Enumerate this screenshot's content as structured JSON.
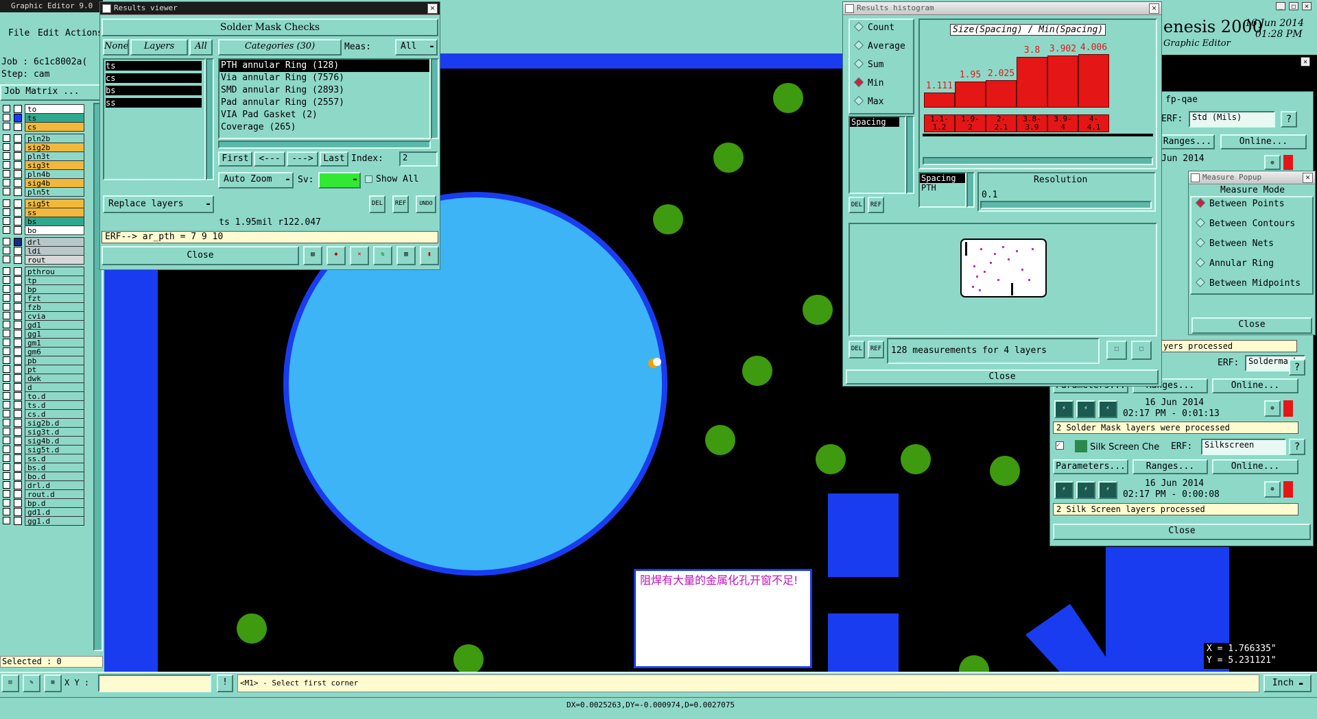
{
  "main_window": {
    "menus": [
      "File",
      "Edit",
      "Actions"
    ],
    "window_title": "Graphic Editor 9.0",
    "job_label": "Job : 6c1c8002a(",
    "step_label": "Step: cam",
    "job_matrix_button": "Job Matrix ...",
    "selected_label": "Selected : 0",
    "app_brand": "enesis 2000",
    "app_sub": "Graphic Editor",
    "date": "16 Jun 2014",
    "time": "01:28 PM",
    "coord_x": "X = 1.766335\"",
    "coord_y": "Y = 5.231121\"",
    "xy_label": "X Y :",
    "xy_value": "",
    "prompt": "<M1> - Select first corner",
    "unit": "Inch",
    "status": "DX=0.0025263,DY=-0.000974,D=0.0027075",
    "annotation": "阻焊有大量的金属化孔开窗不足!"
  },
  "colors": {
    "teal": "#8ed8c8",
    "board_blue": "#1a3cf0",
    "pad_light_blue": "#3cb4f5",
    "pad_green": "#3e9a0e",
    "hist_red": "#e51616",
    "layer_yellow": "#f2b83c",
    "layer_teal": "#2fa88e"
  },
  "layers": [
    {
      "name": "to",
      "color": "#ffffff",
      "fill": "#ffffff"
    },
    {
      "name": "ts",
      "color": "#1a3cf0",
      "fill": "#2fa88e"
    },
    {
      "name": "cs",
      "color": "#ffffff",
      "fill": "#f2b83c"
    },
    {
      "name": "pln2b",
      "color": "#ffffff",
      "fill": "#8ed8c8"
    },
    {
      "name": "sig2b",
      "color": "#ffffff",
      "fill": "#f2b83c"
    },
    {
      "name": "pln3t",
      "color": "#ffffff",
      "fill": "#8ed8c8"
    },
    {
      "name": "sig3t",
      "color": "#ffffff",
      "fill": "#f2b83c"
    },
    {
      "name": "pln4b",
      "color": "#ffffff",
      "fill": "#8ed8c8"
    },
    {
      "name": "sig4b",
      "color": "#ffffff",
      "fill": "#f2b83c"
    },
    {
      "name": "pln5t",
      "color": "#ffffff",
      "fill": "#8ed8c8"
    },
    {
      "name": "sig5t",
      "color": "#ffffff",
      "fill": "#f2b83c"
    },
    {
      "name": "ss",
      "color": "#ffffff",
      "fill": "#f2b83c"
    },
    {
      "name": "bs",
      "color": "#ffffff",
      "fill": "#2fa88e"
    },
    {
      "name": "bo",
      "color": "#ffffff",
      "fill": "#ffffff"
    },
    {
      "name": "drl",
      "color": "#1a2a80",
      "fill": "#b8c8c8"
    },
    {
      "name": "ldi",
      "color": "#ffffff",
      "fill": "#b8c8c8"
    },
    {
      "name": "rout",
      "color": "#ffffff",
      "fill": "#d8d8d8"
    },
    {
      "name": "pthrou",
      "color": "#ffffff",
      "fill": "#8ed8c8"
    },
    {
      "name": "tp",
      "color": "#ffffff",
      "fill": "#8ed8c8"
    },
    {
      "name": "bp",
      "color": "#ffffff",
      "fill": "#8ed8c8"
    },
    {
      "name": "fzt",
      "color": "#ffffff",
      "fill": "#8ed8c8"
    },
    {
      "name": "fzb",
      "color": "#ffffff",
      "fill": "#8ed8c8"
    },
    {
      "name": "cvia",
      "color": "#ffffff",
      "fill": "#8ed8c8"
    },
    {
      "name": "gd1",
      "color": "#ffffff",
      "fill": "#8ed8c8"
    },
    {
      "name": "gg1",
      "color": "#ffffff",
      "fill": "#8ed8c8"
    },
    {
      "name": "gm1",
      "color": "#ffffff",
      "fill": "#8ed8c8"
    },
    {
      "name": "gm6",
      "color": "#ffffff",
      "fill": "#8ed8c8"
    },
    {
      "name": "pb",
      "color": "#ffffff",
      "fill": "#8ed8c8"
    },
    {
      "name": "pt",
      "color": "#ffffff",
      "fill": "#8ed8c8"
    },
    {
      "name": "dwk",
      "color": "#ffffff",
      "fill": "#8ed8c8"
    },
    {
      "name": "d",
      "color": "#ffffff",
      "fill": "#8ed8c8"
    },
    {
      "name": "to.d",
      "color": "#ffffff",
      "fill": "#8ed8c8"
    },
    {
      "name": "ts.d",
      "color": "#ffffff",
      "fill": "#8ed8c8"
    },
    {
      "name": "cs.d",
      "color": "#ffffff",
      "fill": "#8ed8c8"
    },
    {
      "name": "sig2b.d",
      "color": "#ffffff",
      "fill": "#8ed8c8"
    },
    {
      "name": "sig3t.d",
      "color": "#ffffff",
      "fill": "#8ed8c8"
    },
    {
      "name": "sig4b.d",
      "color": "#ffffff",
      "fill": "#8ed8c8"
    },
    {
      "name": "sig5t.d",
      "color": "#ffffff",
      "fill": "#8ed8c8"
    },
    {
      "name": "ss.d",
      "color": "#ffffff",
      "fill": "#8ed8c8"
    },
    {
      "name": "bs.d",
      "color": "#ffffff",
      "fill": "#8ed8c8"
    },
    {
      "name": "bo.d",
      "color": "#ffffff",
      "fill": "#8ed8c8"
    },
    {
      "name": "drl.d",
      "color": "#ffffff",
      "fill": "#8ed8c8"
    },
    {
      "name": "rout.d",
      "color": "#ffffff",
      "fill": "#8ed8c8"
    },
    {
      "name": "bp.d",
      "color": "#ffffff",
      "fill": "#8ed8c8"
    },
    {
      "name": "gd1.d",
      "color": "#ffffff",
      "fill": "#8ed8c8"
    },
    {
      "name": "gg1.d",
      "color": "#ffffff",
      "fill": "#8ed8c8"
    }
  ],
  "results_viewer": {
    "title": "Results viewer",
    "header": "Solder Mask Checks",
    "none_btn": "None",
    "layers_btn": "Layers",
    "all_btn": "All",
    "categories_label": "Categories (30)",
    "meas_label": "Meas:",
    "meas_value": "All",
    "layers": [
      "ts",
      "cs",
      "bs",
      "ss"
    ],
    "categories": [
      "PTH annular Ring (128)",
      "Via annular Ring (7576)",
      "SMD annular Ring (2893)",
      "Pad annular Ring (2557)",
      "VIA Pad Gasket (2)",
      "Coverage (265)"
    ],
    "first_btn": "First",
    "prev_btn": "<---",
    "next_btn": "--->",
    "last_btn": "Last",
    "index_label": "Index:",
    "index_value": "2",
    "auto_zoom": "Auto Zoom",
    "sv_label": "Sv:",
    "show_all": "Show All",
    "replace_layers": "Replace layers",
    "del_icon": "DEL",
    "ref_icon": "REF",
    "undo_icon": "UNDO",
    "measure_info": "ts  1.95mil   r122.047",
    "erf_info": "ERF--> ar_pth = 7 9 10",
    "close": "Close"
  },
  "histogram": {
    "title": "Results histogram",
    "modes": [
      "Count",
      "Average",
      "Sum",
      "Min",
      "Max"
    ],
    "selected_mode": "Min",
    "chart_title": "Size(Spacing) / Min(Spacing)",
    "spacing_item": "Spacing",
    "pth_item": "PTH",
    "resolution_label": "Resolution",
    "resolution_value": "0.1",
    "summary": "128 measurements for 4 layers",
    "close": "Close"
  },
  "chart_data": {
    "type": "bar",
    "title": "Size(Spacing) / Min(Spacing)",
    "categories": [
      "1.1-1.2",
      "1.9-2",
      "2-2.1",
      "3.8-3.9",
      "3.9-4",
      "4-4.1"
    ],
    "category_lines": [
      [
        "1.1-",
        "1.2"
      ],
      [
        "1.9-",
        "2"
      ],
      [
        "2-",
        "2.1"
      ],
      [
        "3.8-",
        "3.9"
      ],
      [
        "3.9-",
        "4"
      ],
      [
        "4-",
        "4.1"
      ]
    ],
    "values": [
      1.111,
      1.95,
      2.025,
      3.8,
      3.902,
      4.006
    ],
    "labels": [
      "1.111",
      "1.95",
      "2.025",
      "3.8",
      "3.902",
      "4.006"
    ],
    "ylim": [
      0,
      4.2
    ]
  },
  "checklist": {
    "title": "fp-qae",
    "erf_label": "ERF:",
    "std_value": "Std (Mils)",
    "online": "Online...",
    "ranges": "Ranges...",
    "parameters": "Parameters...",
    "partial_date": "Jun 2014",
    "soldermask": {
      "erf_value": "Soldermask",
      "date": "16 Jun 2014",
      "time": "02:17 PM - 0:01:13",
      "status": "2 Solder Mask layers were processed"
    },
    "silkscreen": {
      "name": "Silk Screen Che",
      "erf_value": "Silkscreen",
      "date": "16 Jun 2014",
      "time": "02:17 PM - 0:00:08",
      "status": "2 Silk Screen layers processed"
    },
    "layers_processed_partial": "yers processed",
    "close": "Close"
  },
  "measure_popup": {
    "title": "Measure Popup",
    "header": "Measure Mode",
    "modes": [
      "Between Points",
      "Between Contours",
      "Between Nets",
      "Annular Ring",
      "Between Midpoints"
    ],
    "selected": "Between Points",
    "close": "Close"
  }
}
